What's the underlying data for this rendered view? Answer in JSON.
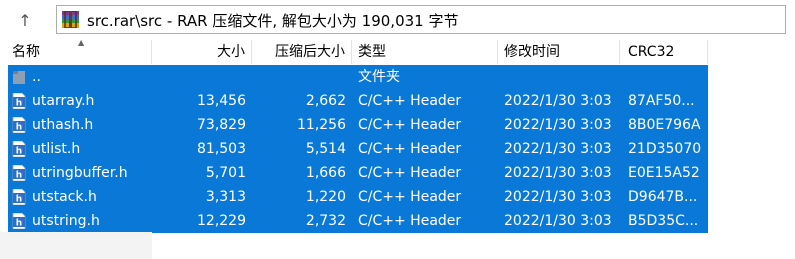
{
  "path_bar": {
    "up_glyph": "↑",
    "path_text": "src.rar\\src - RAR 压缩文件, 解包大小为 190,031 字节",
    "icon": "rar-archive-icon"
  },
  "columns": [
    "名称",
    "大小",
    "压缩后大小",
    "类型",
    "修改时间",
    "CRC32"
  ],
  "rows": [
    {
      "name": "..",
      "size": "",
      "packed": "",
      "type": "文件夹",
      "modified": "",
      "crc": "",
      "icon": "folder-up-icon"
    },
    {
      "name": "utarray.h",
      "size": "13,456",
      "packed": "2,662",
      "type": "C/C++ Header",
      "modified": "2022/1/30 3:03",
      "crc": "87AF50...",
      "icon": "header-file-icon"
    },
    {
      "name": "uthash.h",
      "size": "73,829",
      "packed": "11,256",
      "type": "C/C++ Header",
      "modified": "2022/1/30 3:03",
      "crc": "8B0E796A",
      "icon": "header-file-icon"
    },
    {
      "name": "utlist.h",
      "size": "81,503",
      "packed": "5,514",
      "type": "C/C++ Header",
      "modified": "2022/1/30 3:03",
      "crc": "21D35070",
      "icon": "header-file-icon"
    },
    {
      "name": "utringbuffer.h",
      "size": "5,701",
      "packed": "1,666",
      "type": "C/C++ Header",
      "modified": "2022/1/30 3:03",
      "crc": "E0E15A52",
      "icon": "header-file-icon"
    },
    {
      "name": "utstack.h",
      "size": "3,313",
      "packed": "1,220",
      "type": "C/C++ Header",
      "modified": "2022/1/30 3:03",
      "crc": "D9647B...",
      "icon": "header-file-icon"
    },
    {
      "name": "utstring.h",
      "size": "12,229",
      "packed": "2,732",
      "type": "C/C++ Header",
      "modified": "2022/1/30 3:03",
      "crc": "B5D35C...",
      "icon": "header-file-icon"
    }
  ],
  "colors": {
    "selection": "#0a78d7",
    "selection_text": "#ffffff"
  }
}
